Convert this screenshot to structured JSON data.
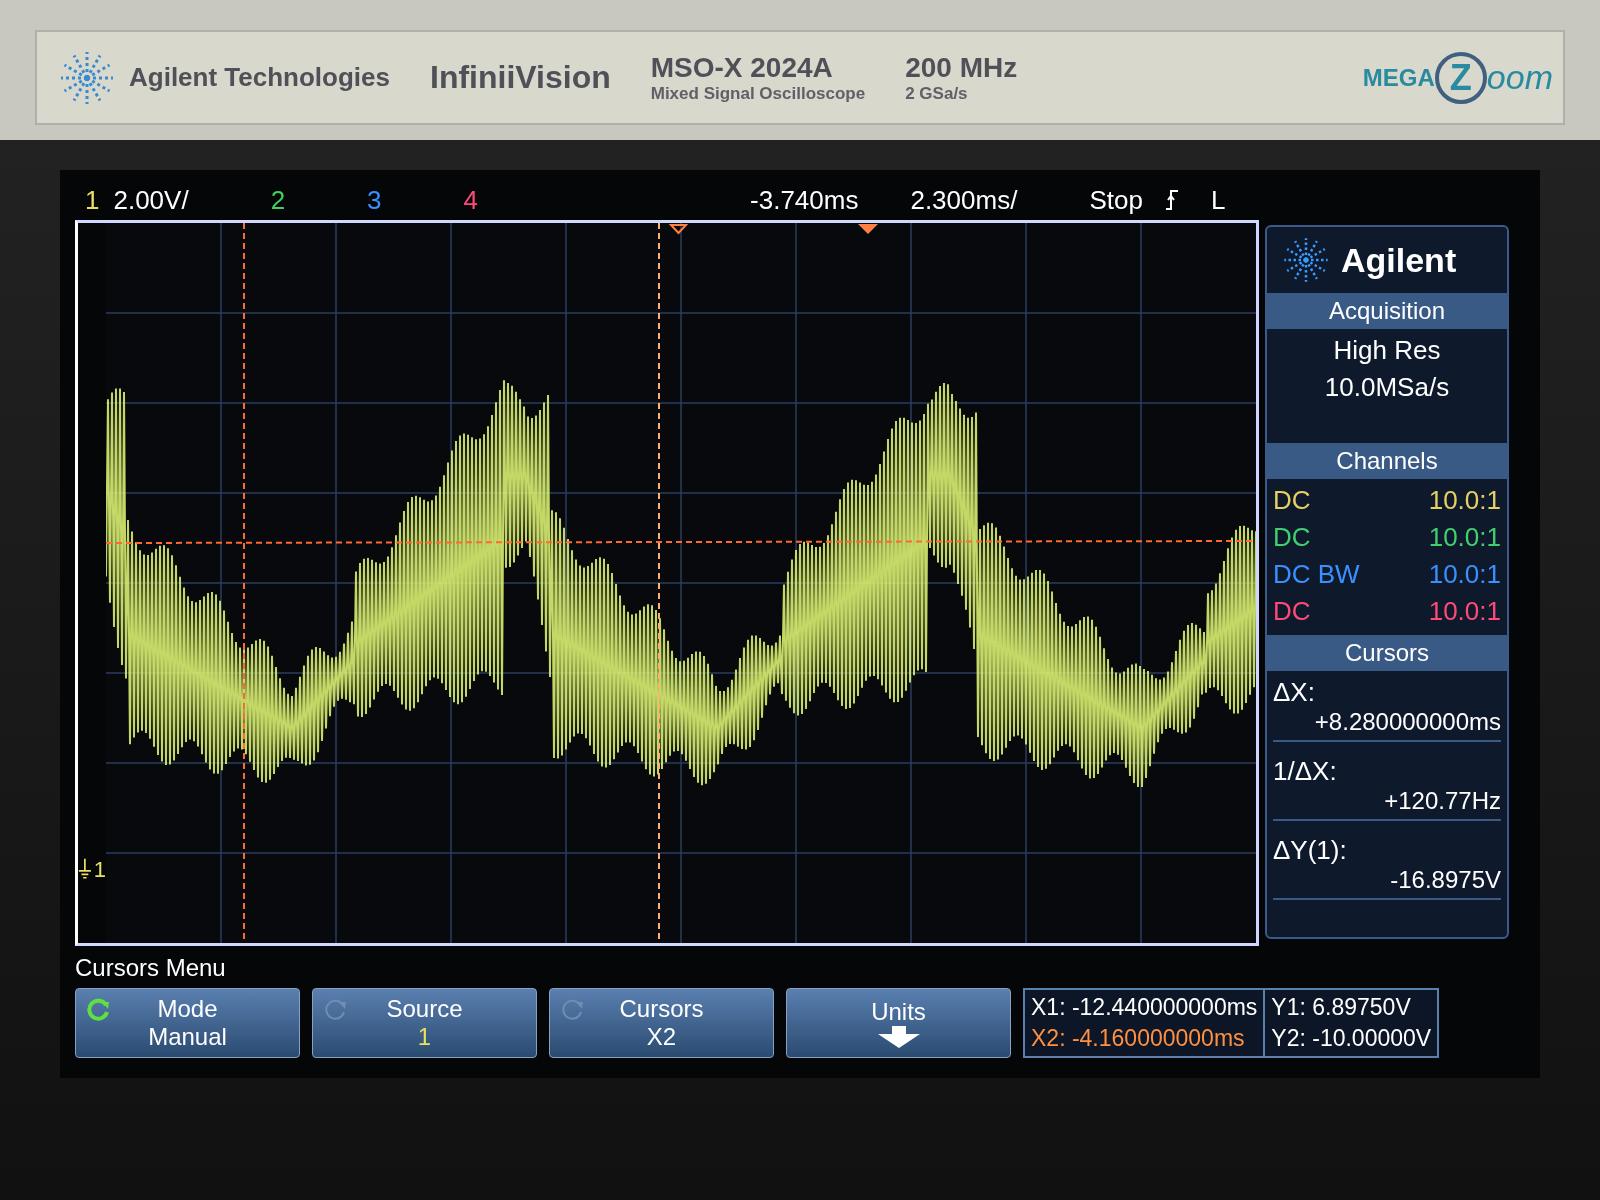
{
  "bezel": {
    "brand": "Agilent Technologies",
    "series": "InfiniiVision",
    "model": "MSO-X 2024A",
    "model_subtitle": "Mixed Signal Oscilloscope",
    "bandwidth": "200 MHz",
    "sample_rate": "2 GSa/s",
    "logo_parts": [
      "MEGA",
      "Z",
      "oom"
    ]
  },
  "status_bar": {
    "items": [
      {
        "kind": "channel",
        "text": "1",
        "color": "#e8e060"
      },
      {
        "kind": "scale",
        "text": "2.00V/"
      },
      {
        "kind": "channel",
        "text": "2",
        "color": "#40d060"
      },
      {
        "kind": "channel",
        "text": "3",
        "color": "#3a90ff"
      },
      {
        "kind": "channel",
        "text": "4",
        "color": "#ff4a78"
      }
    ],
    "delay": "-3.740ms",
    "timebase": "2.300ms/",
    "run_state": "Stop",
    "trigger_level": "L"
  },
  "plot": {
    "ground_marker": "1"
  },
  "side_panel": {
    "logo": "Agilent",
    "acquisition": {
      "title": "Acquisition",
      "lines": [
        "High Res",
        "10.0MSa/s"
      ]
    },
    "channels": {
      "title": "Channels",
      "rows": [
        {
          "coupling": "DC",
          "probe": "10.0:1",
          "color": "#e8d060"
        },
        {
          "coupling": "DC",
          "probe": "10.0:1",
          "color": "#40d070"
        },
        {
          "coupling": "DC BW",
          "probe": "10.0:1",
          "color": "#3a90ff"
        },
        {
          "coupling": "DC",
          "probe": "10.0:1",
          "color": "#ff4a78"
        }
      ]
    },
    "cursors": {
      "title": "Cursors",
      "readouts": [
        {
          "label": "ΔX:",
          "value": "+8.280000000ms"
        },
        {
          "label": "1/ΔX:",
          "value": "+120.77Hz"
        },
        {
          "label": "ΔY(1):",
          "value": "-16.8975V"
        }
      ]
    }
  },
  "menu": {
    "title": "Cursors Menu",
    "softkeys": [
      {
        "kind": "cycle",
        "label": "Mode",
        "value": "Manual",
        "active": true
      },
      {
        "kind": "cycle",
        "label": "Source",
        "value": "1",
        "active": false,
        "color": "#e8e060"
      },
      {
        "kind": "cycle",
        "label": "Cursors",
        "value": "X2",
        "active": false
      },
      {
        "kind": "submenu",
        "label": "Units"
      }
    ],
    "x_readouts": [
      {
        "text": "X1: -12.440000000ms",
        "color": "#ffffff"
      },
      {
        "text": "X2: -4.160000000ms",
        "color": "#ff9040"
      }
    ],
    "y_readouts": [
      "Y1: 6.89750V",
      "Y2: -10.00000V"
    ]
  }
}
